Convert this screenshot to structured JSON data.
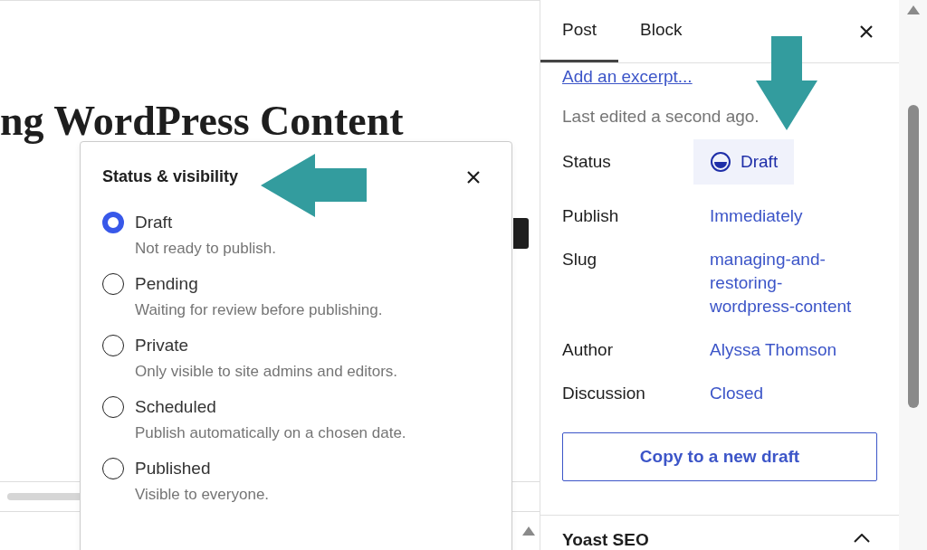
{
  "editor": {
    "title_fragment": "ng WordPress Content"
  },
  "popover": {
    "title": "Status & visibility",
    "options": [
      {
        "label": "Draft",
        "description": "Not ready to publish.",
        "selected": true
      },
      {
        "label": "Pending",
        "description": "Waiting for review before publishing.",
        "selected": false
      },
      {
        "label": "Private",
        "description": "Only visible to site admins and editors.",
        "selected": false
      },
      {
        "label": "Scheduled",
        "description": "Publish automatically on a chosen date.",
        "selected": false
      },
      {
        "label": "Published",
        "description": "Visible to everyone.",
        "selected": false
      }
    ]
  },
  "sidebar": {
    "tabs": [
      {
        "label": "Post",
        "selected": true
      },
      {
        "label": "Block",
        "selected": false
      }
    ],
    "excerpt_link": "Add an excerpt...",
    "last_edited": "Last edited a second ago.",
    "fields": [
      {
        "label": "Status",
        "value": "Draft",
        "kind": "status"
      },
      {
        "label": "Publish",
        "value": "Immediately",
        "kind": "link"
      },
      {
        "label": "Slug",
        "value": "managing-and-restoring-wordpress-content",
        "kind": "link"
      },
      {
        "label": "Author",
        "value": "Alyssa Thomson",
        "kind": "link"
      },
      {
        "label": "Discussion",
        "value": "Closed",
        "kind": "link"
      }
    ],
    "copy_button": "Copy to a new draft",
    "panels": [
      {
        "title": "Yoast SEO",
        "expanded": true
      }
    ]
  }
}
